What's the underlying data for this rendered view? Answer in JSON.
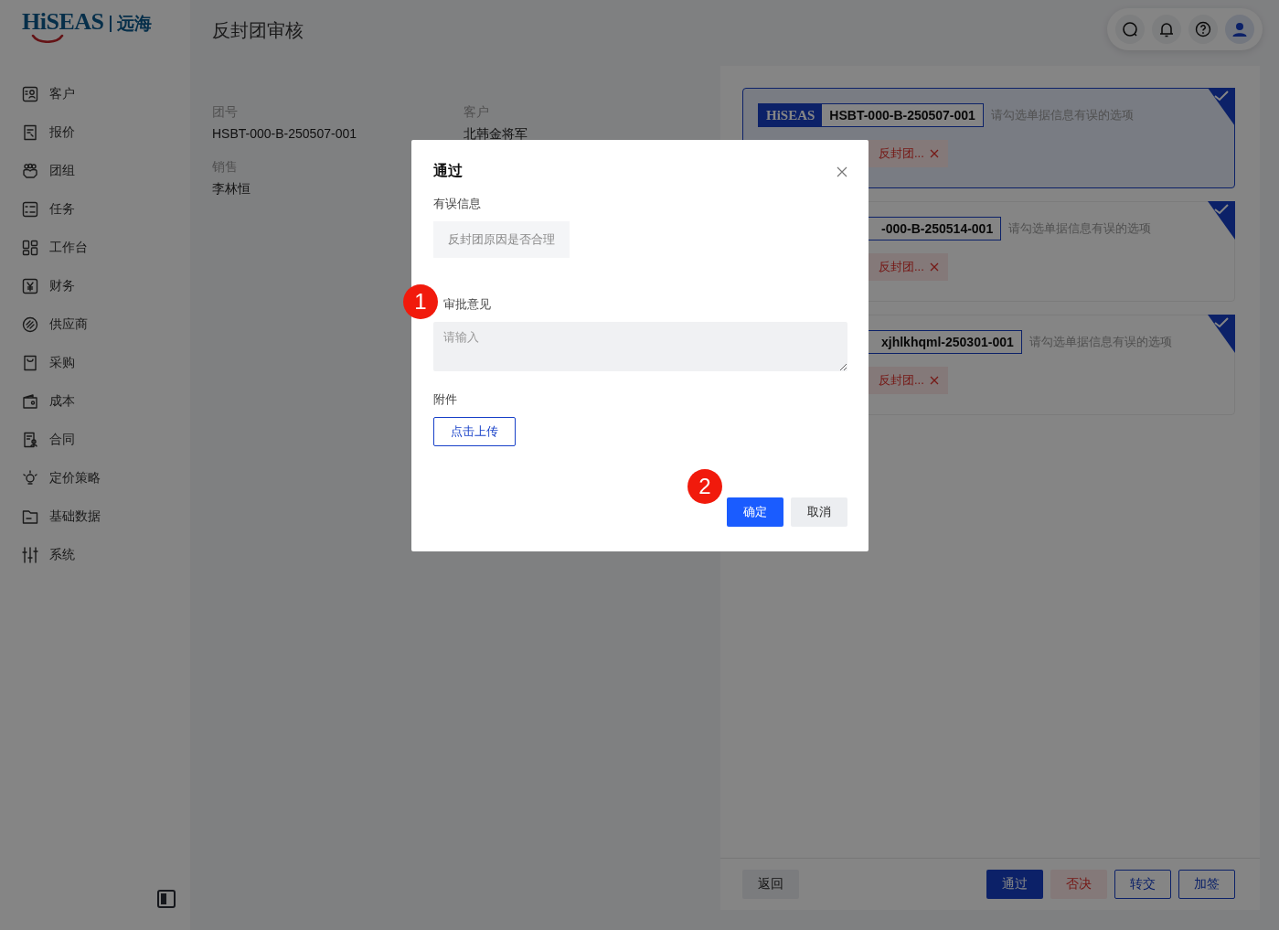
{
  "brand": {
    "name": "HiSEAS",
    "cn": "远海"
  },
  "sidebar": {
    "items": [
      {
        "label": "客户"
      },
      {
        "label": "报价"
      },
      {
        "label": "团组"
      },
      {
        "label": "任务"
      },
      {
        "label": "工作台"
      },
      {
        "label": "财务"
      },
      {
        "label": "供应商"
      },
      {
        "label": "采购"
      },
      {
        "label": "成本"
      },
      {
        "label": "合同"
      },
      {
        "label": "定价策略"
      },
      {
        "label": "基础数据"
      },
      {
        "label": "系统"
      }
    ]
  },
  "page": {
    "title": "反封团审核"
  },
  "info": [
    {
      "label": "团号",
      "value": "HSBT-000-B-250507-001"
    },
    {
      "label": "客户",
      "value": "北韩金将军"
    },
    {
      "label": "销售",
      "value": "李林恒"
    }
  ],
  "cards": [
    {
      "logo": "HiSEAS",
      "id": "HSBT-000-B-250507-001",
      "hint": "请勾选单据信息有误的选项",
      "tag": "反封团...",
      "selected": true,
      "checked": true
    },
    {
      "id": "-000-B-250514-001",
      "hint": "请勾选单据信息有误的选项",
      "tag": "反封团...",
      "selected": false,
      "checked": true
    },
    {
      "id": "xjhlkhqml-250301-001",
      "hint": "请勾选单据信息有误的选项",
      "tag": "反封团...",
      "selected": false,
      "checked": true
    }
  ],
  "actions": [
    {
      "label": "返回",
      "kind": "back"
    },
    {
      "label": "通过",
      "kind": "primary"
    },
    {
      "label": "否决",
      "kind": "danger"
    },
    {
      "label": "转交",
      "kind": "outline"
    },
    {
      "label": "加签",
      "kind": "outline"
    }
  ],
  "dialog": {
    "title": "通过",
    "fields": [
      {
        "kind": "chip",
        "label": "有误信息",
        "value": "反封团原因是否合理"
      },
      {
        "kind": "textarea",
        "label": "审批意见",
        "placeholder": "请输入",
        "marker": "1"
      },
      {
        "kind": "upload",
        "label": "附件",
        "button": "点击上传"
      }
    ],
    "buttons": [
      {
        "label": "确定",
        "kind": "primary",
        "marker": "2"
      },
      {
        "label": "取消",
        "kind": "secondary"
      }
    ]
  }
}
